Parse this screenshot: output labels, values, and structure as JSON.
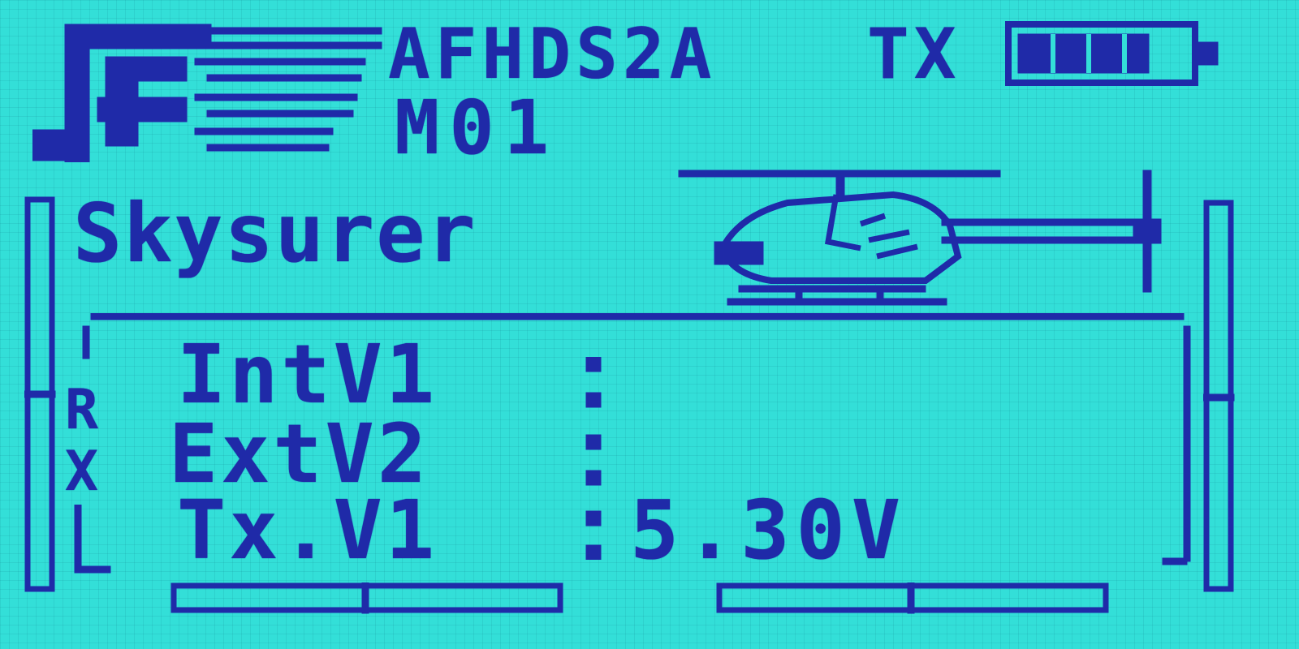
{
  "header": {
    "protocol": "AFHDS2A",
    "device": "TX",
    "model_number": "M01",
    "battery_level": 0.75
  },
  "model": {
    "name": "Skysurer",
    "icon": "helicopter-icon"
  },
  "voltages": [
    {
      "label": "IntV1",
      "value": ""
    },
    {
      "label": "ExtV2",
      "value": ""
    },
    {
      "label": "Tx.V1",
      "value": "5.30V"
    }
  ],
  "rx_indicator": [
    "R",
    "X"
  ],
  "colors": {
    "lcd_background": "#33dfd8",
    "lcd_ink": "#1f2aa8"
  }
}
